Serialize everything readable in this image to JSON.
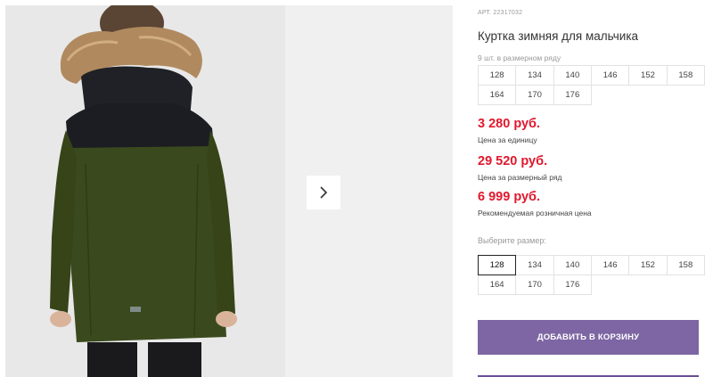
{
  "product": {
    "sku": "АРТ. 22317032",
    "title": "Куртка зимняя для мальчика",
    "row_info": "9 шт. в размерном ряду",
    "row_sizes": [
      "128",
      "134",
      "140",
      "146",
      "152",
      "158",
      "164",
      "170",
      "176"
    ],
    "prices": [
      {
        "value": "3 280 руб.",
        "note": "Цена за единицу"
      },
      {
        "value": "29 520 руб.",
        "note": "Цена за размерный ряд"
      },
      {
        "value": "6 999 руб.",
        "note": "Рекомендуемая розничная цена"
      }
    ],
    "choose_size_label": "Выберите размер:",
    "select_sizes": [
      "128",
      "134",
      "140",
      "146",
      "152",
      "158",
      "164",
      "170",
      "176"
    ],
    "selected_size": "128",
    "add_to_cart_label": "ДОБАВИТЬ В КОРЗИНУ"
  },
  "gallery": {
    "next_icon": "chevron-right-icon"
  },
  "colors": {
    "price": "#e0182d",
    "button": "#7d66a3",
    "jacket_green": "#3b4a1e",
    "jacket_black": "#1b1d22"
  }
}
